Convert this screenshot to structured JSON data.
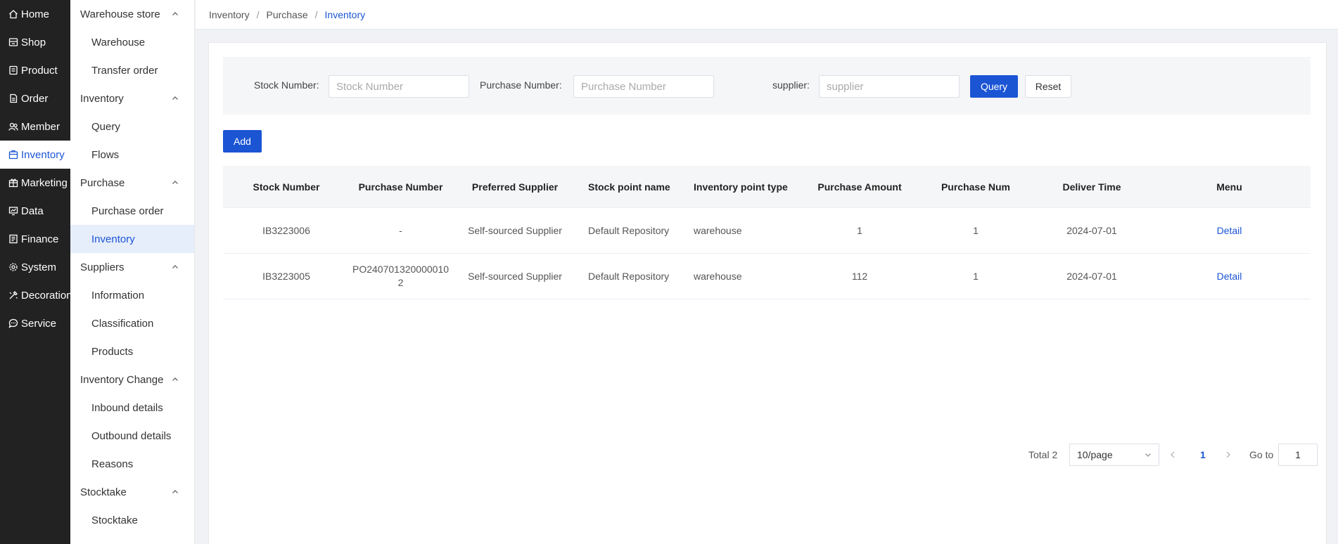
{
  "nav_primary": [
    {
      "label": "Home",
      "icon": "home-icon"
    },
    {
      "label": "Shop",
      "icon": "shop-icon"
    },
    {
      "label": "Product",
      "icon": "product-icon"
    },
    {
      "label": "Order",
      "icon": "order-icon"
    },
    {
      "label": "Member",
      "icon": "member-icon"
    },
    {
      "label": "Inventory",
      "icon": "inventory-icon",
      "active": true
    },
    {
      "label": "Marketing",
      "icon": "marketing-icon"
    },
    {
      "label": "Data",
      "icon": "data-icon"
    },
    {
      "label": "Finance",
      "icon": "finance-icon"
    },
    {
      "label": "System",
      "icon": "system-icon"
    },
    {
      "label": "Decoration",
      "icon": "decoration-icon"
    },
    {
      "label": "Service",
      "icon": "service-icon"
    }
  ],
  "nav_secondary": {
    "warehouse": {
      "title": "Warehouse store",
      "items": [
        "Warehouse",
        "Transfer order"
      ]
    },
    "inventory": {
      "title": "Inventory",
      "items": [
        "Query",
        "Flows"
      ]
    },
    "purchase": {
      "title": "Purchase",
      "items": [
        "Purchase order",
        "Inventory"
      ]
    },
    "suppliers": {
      "title": "Suppliers",
      "items": [
        "Information",
        "Classification",
        "Products"
      ]
    },
    "change": {
      "title": "Inventory Change",
      "items": [
        "Inbound details",
        "Outbound details",
        "Reasons"
      ]
    },
    "stocktake": {
      "title": "Stocktake",
      "items": [
        "Stocktake"
      ]
    }
  },
  "breadcrumb": [
    "Inventory",
    "Purchase",
    "Inventory"
  ],
  "filter": {
    "stock_label": "Stock Number:",
    "stock_placeholder": "Stock Number",
    "purchase_label": "Purchase Number:",
    "purchase_placeholder": "Purchase Number",
    "supplier_label": "supplier:",
    "supplier_placeholder": "supplier",
    "query_label": "Query",
    "reset_label": "Reset"
  },
  "add_label": "Add",
  "table": {
    "columns": [
      "Stock Number",
      "Purchase Number",
      "Preferred Supplier",
      "Stock point name",
      "Inventory point type",
      "Purchase Amount",
      "Purchase Num",
      "Deliver Time",
      "Menu"
    ],
    "rows": [
      {
        "stock_number": "IB3223006",
        "purchase_number": "-",
        "supplier": "Self-sourced Supplier",
        "stock_point": "Default Repository",
        "point_type": "warehouse",
        "amount": "1",
        "num": "1",
        "deliver_time": "2024-07-01",
        "menu": "Detail"
      },
      {
        "stock_number": "IB3223005",
        "purchase_number": "PO240701320000010 2",
        "supplier": "Self-sourced Supplier",
        "stock_point": "Default Repository",
        "point_type": "warehouse",
        "amount": "112",
        "num": "1",
        "deliver_time": "2024-07-01",
        "menu": "Detail"
      }
    ]
  },
  "pagination": {
    "total": "Total 2",
    "page_size": "10/page",
    "current_page": "1",
    "goto_label": "Go to",
    "goto_value": "1"
  },
  "colors": {
    "accent": "#1b55d4",
    "nav_bg": "#222222",
    "active_bg": "#e6edfb"
  }
}
